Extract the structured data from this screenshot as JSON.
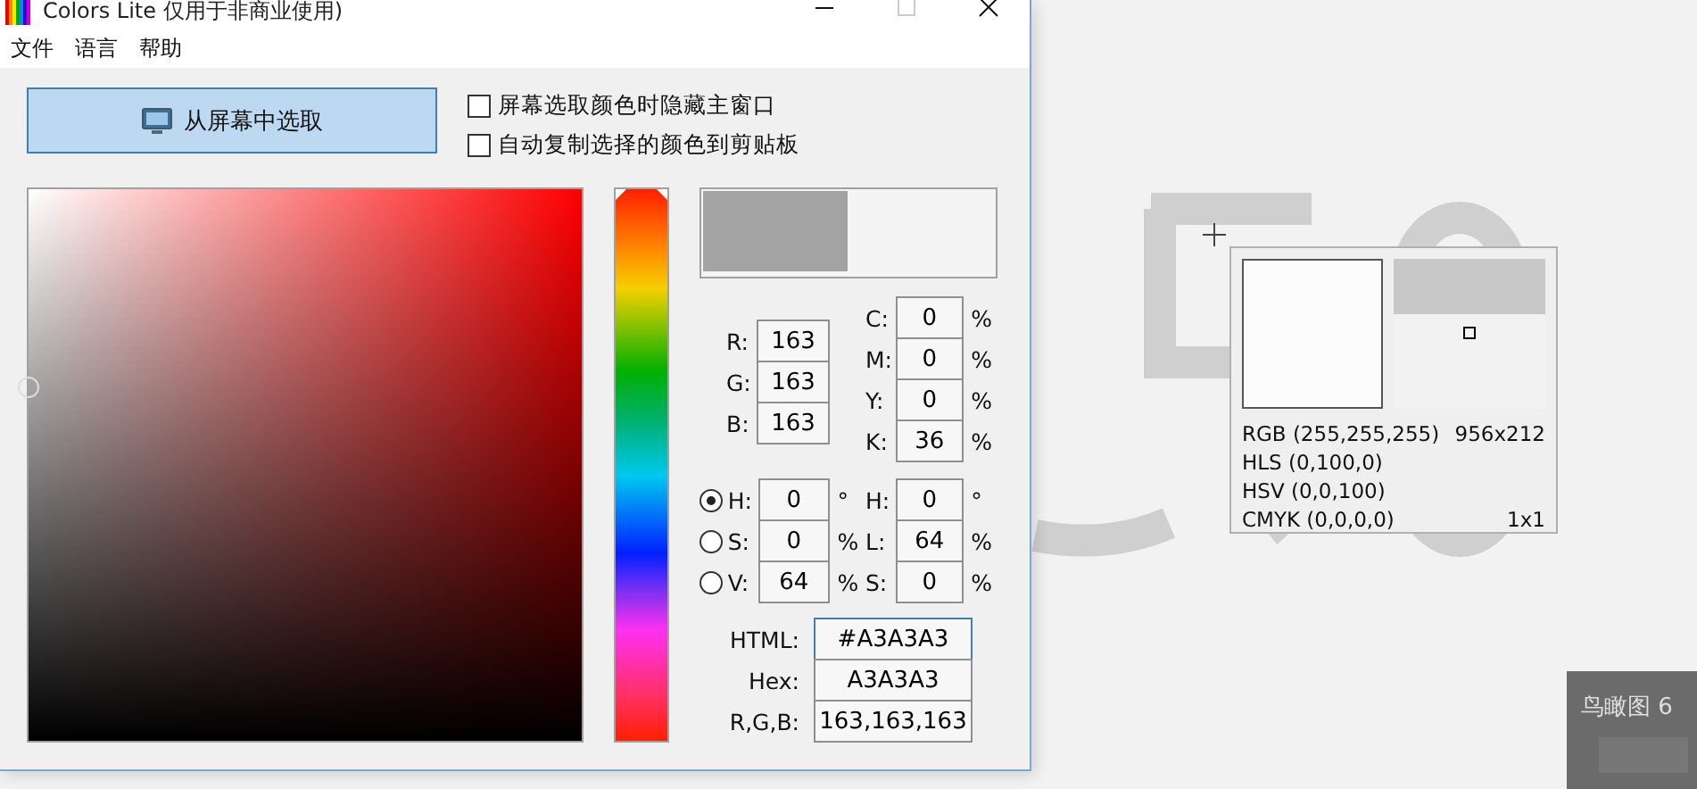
{
  "window": {
    "title": "Colors Lite 仅用于非商业使用)"
  },
  "menu": [
    "文件",
    "语言",
    "帮助"
  ],
  "pick_button": {
    "label": "从屏幕中选取"
  },
  "options": [
    {
      "label": "屏幕选取颜色时隐藏主窗口",
      "checked": false
    },
    {
      "label": "自动复制选择的颜色到剪贴板",
      "checked": false
    }
  ],
  "hue_slider": {
    "level": 0
  },
  "rgb": [
    {
      "label": "R:",
      "value": "163"
    },
    {
      "label": "G:",
      "value": "163"
    },
    {
      "label": "B:",
      "value": "163"
    }
  ],
  "cmyk": [
    {
      "label": "C:",
      "value": "0",
      "unit": "%"
    },
    {
      "label": "M:",
      "value": "0",
      "unit": "%"
    },
    {
      "label": "Y:",
      "value": "0",
      "unit": "%"
    },
    {
      "label": "K:",
      "value": "36",
      "unit": "%"
    }
  ],
  "hsv": [
    {
      "label": "H:",
      "value": "0",
      "unit": "°",
      "selected": true
    },
    {
      "label": "S:",
      "value": "0",
      "unit": "%",
      "selected": false
    },
    {
      "label": "V:",
      "value": "64",
      "unit": "%",
      "selected": false
    }
  ],
  "hsl": [
    {
      "label": "H:",
      "value": "0",
      "unit": "°"
    },
    {
      "label": "L:",
      "value": "64",
      "unit": "%"
    },
    {
      "label": "S:",
      "value": "0",
      "unit": "%"
    }
  ],
  "codes": [
    {
      "label": "HTML:",
      "value": "#A3A3A3",
      "focused": true
    },
    {
      "label": "Hex:",
      "value": "A3A3A3",
      "focused": false
    },
    {
      "label": "R,G,B:",
      "value": "163,163,163",
      "focused": false
    }
  ],
  "magnifier": {
    "lines": [
      {
        "text": "RGB (255,255,255)",
        "extra": "956x212"
      },
      {
        "text": "HLS (0,100,0)"
      },
      {
        "text": "HSV (0,0,100)"
      },
      {
        "text": "CMYK (0,0,0,0)",
        "extra": "1x1"
      }
    ]
  },
  "thumbnail": {
    "title": "鸟瞰图 6"
  }
}
